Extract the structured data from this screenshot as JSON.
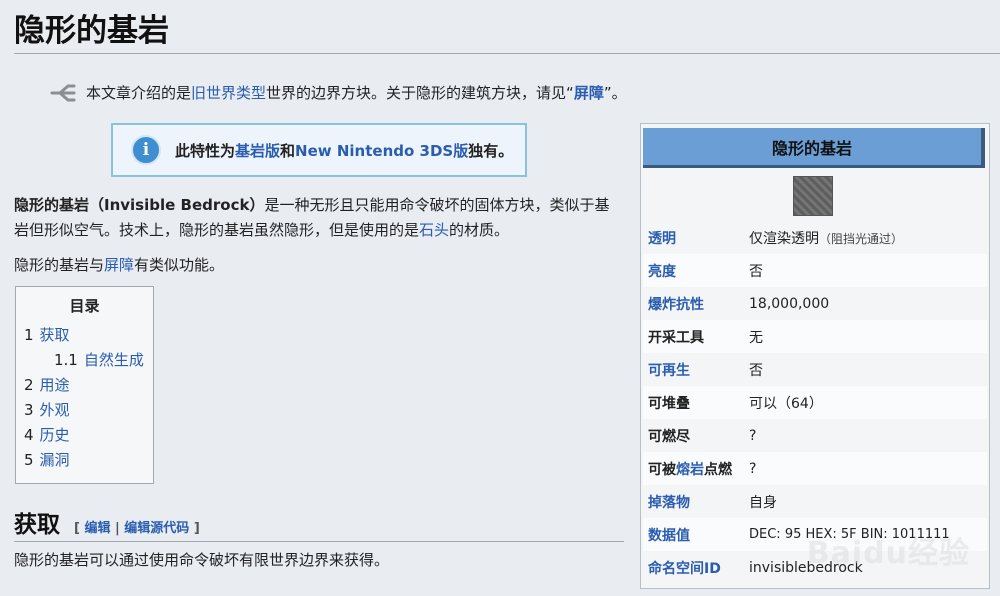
{
  "page": {
    "title": "隐形的基岩"
  },
  "hatnote": {
    "prefix": "本文章介绍的是",
    "link1": "旧世界类型",
    "mid": "世界的边界方块。关于隐形的建筑方块，请见“",
    "link2": "屏障",
    "suffix": "”。"
  },
  "notice": {
    "prefix": "此特性为",
    "link1": "基岩版",
    "mid": "和",
    "link2": "New Nintendo 3DS版",
    "suffix": "独有。"
  },
  "intro": {
    "bold": "隐形的基岩（Invisible Bedrock）",
    "text1": "是一种无形且只能用命令破坏的固体方块，类似于基岩但形似空气。技术上，隐形的基岩虽然隐形，但是使用的是",
    "link": "石头",
    "text2": "的材质。"
  },
  "para2": {
    "prefix": "隐形的基岩与",
    "link": "屏障",
    "suffix": "有类似功能。"
  },
  "toc": {
    "title": "目录",
    "items": [
      {
        "num": "1",
        "label": "获取"
      },
      {
        "num": "1.1",
        "label": "自然生成"
      },
      {
        "num": "2",
        "label": "用途"
      },
      {
        "num": "3",
        "label": "外观"
      },
      {
        "num": "4",
        "label": "历史"
      },
      {
        "num": "5",
        "label": "漏洞"
      }
    ]
  },
  "section": {
    "heading": "获取",
    "edit_open": "[ ",
    "edit1": "编辑",
    "sep": " | ",
    "edit2": "编辑源代码",
    "edit_close": " ]",
    "text": "隐形的基岩可以通过使用命令破坏有限世界边界来获得。"
  },
  "infobox": {
    "title": "隐形的基岩",
    "rows": [
      {
        "label": "透明",
        "value": "仅渲染透明",
        "note": "（阻挡光通过）"
      },
      {
        "label": "亮度",
        "value": "否"
      },
      {
        "label": "爆炸抗性",
        "value": "18,000,000"
      },
      {
        "label": "开采工具",
        "value": "无"
      },
      {
        "label": "可再生",
        "value": "否"
      },
      {
        "label": "可堆叠",
        "value": "可以（64）"
      },
      {
        "label": "可燃尽",
        "value": "?"
      },
      {
        "label_prefix": "可被",
        "label_link": "熔岩",
        "label_suffix": "点燃",
        "value": "?"
      },
      {
        "label": "掉落物",
        "value": "自身"
      },
      {
        "label": "数据值",
        "value": "DEC: 95 HEX: 5F BIN: 1011111"
      },
      {
        "label": "命名空间ID",
        "value": "invisiblebedrock"
      }
    ]
  },
  "watermark": "Baidu经验",
  "colors": {
    "link": "#2a5db0",
    "infobox_header": "#6c9ed6",
    "notice_border": "#88c3da"
  },
  "icons": {
    "hatnote": "disambiguation-icon",
    "notice": "info-icon",
    "infobox_image": "block-image-icon"
  }
}
